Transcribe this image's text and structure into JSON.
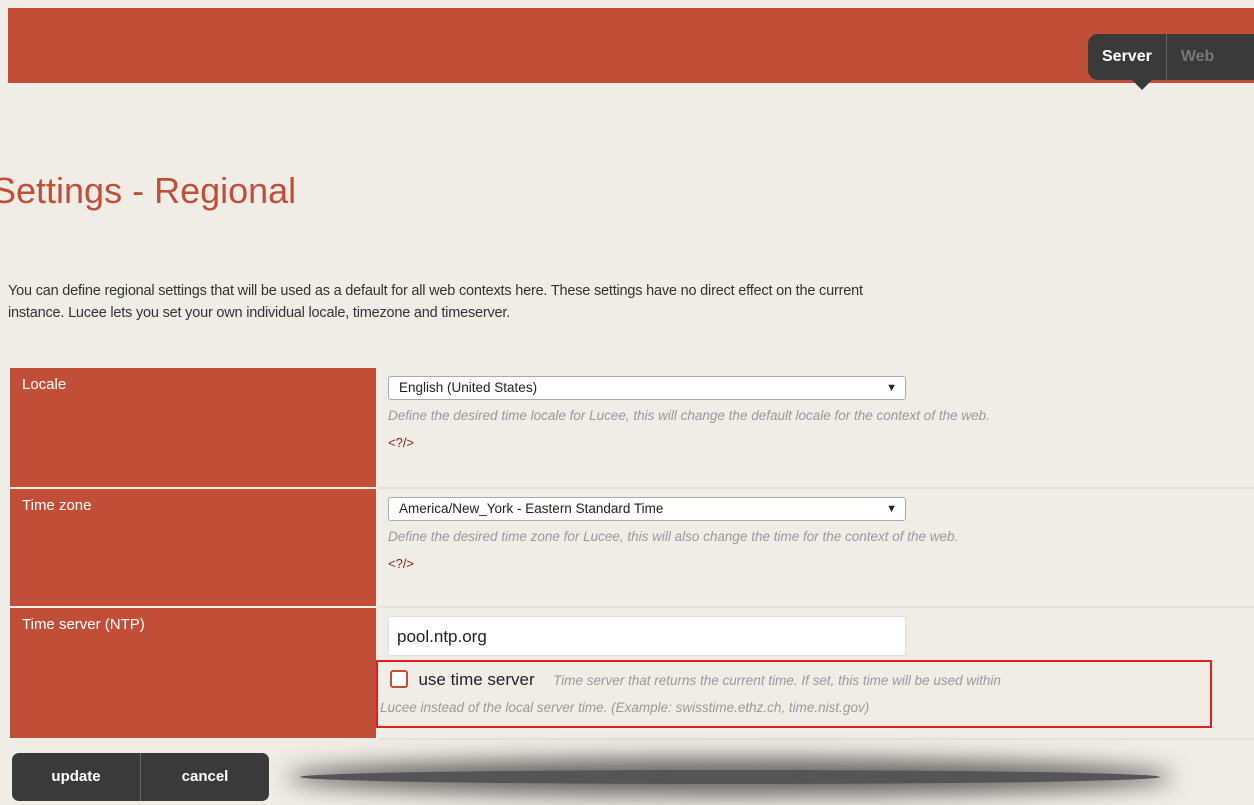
{
  "header": {
    "tabs": [
      {
        "label": "Server",
        "active": true
      },
      {
        "label": "Web",
        "active": false
      }
    ],
    "bar_color": "#c14f37"
  },
  "page_title": "Settings - Regional",
  "intro": {
    "line1": "You can define regional settings that will be used as a default for all web contexts here. These settings have no direct effect on the current",
    "line2": "instance. Lucee lets you set your own individual locale, timezone and timeserver."
  },
  "settings": {
    "locale": {
      "label": "Locale",
      "value": "English (United States)",
      "description": "Define the desired time locale for Lucee, this will change the default locale for the context of the web.",
      "doc_link": "<?/>"
    },
    "timezone": {
      "label": "Time zone",
      "value": "America/New_York - Eastern Standard Time",
      "description": "Define the desired time zone for Lucee, this will also change the time for the context of the web.",
      "doc_link": "<?/>"
    },
    "timeserver": {
      "label": "Time server (NTP)",
      "value": "pool.ntp.org",
      "checkbox_label": "use time server",
      "checkbox_checked": false,
      "description_line1": "Time server that returns the current time. If set, this time will be used within",
      "description_line2": "Lucee instead of the local server time. (Example: swisstime.ethz.ch, time.nist.gov)"
    }
  },
  "buttons": {
    "update": "update",
    "cancel": "cancel"
  },
  "colors": {
    "accent": "#c14f37",
    "highlight_box": "#e1201e",
    "dark": "#3a3a3a",
    "background": "#f0ede7"
  }
}
